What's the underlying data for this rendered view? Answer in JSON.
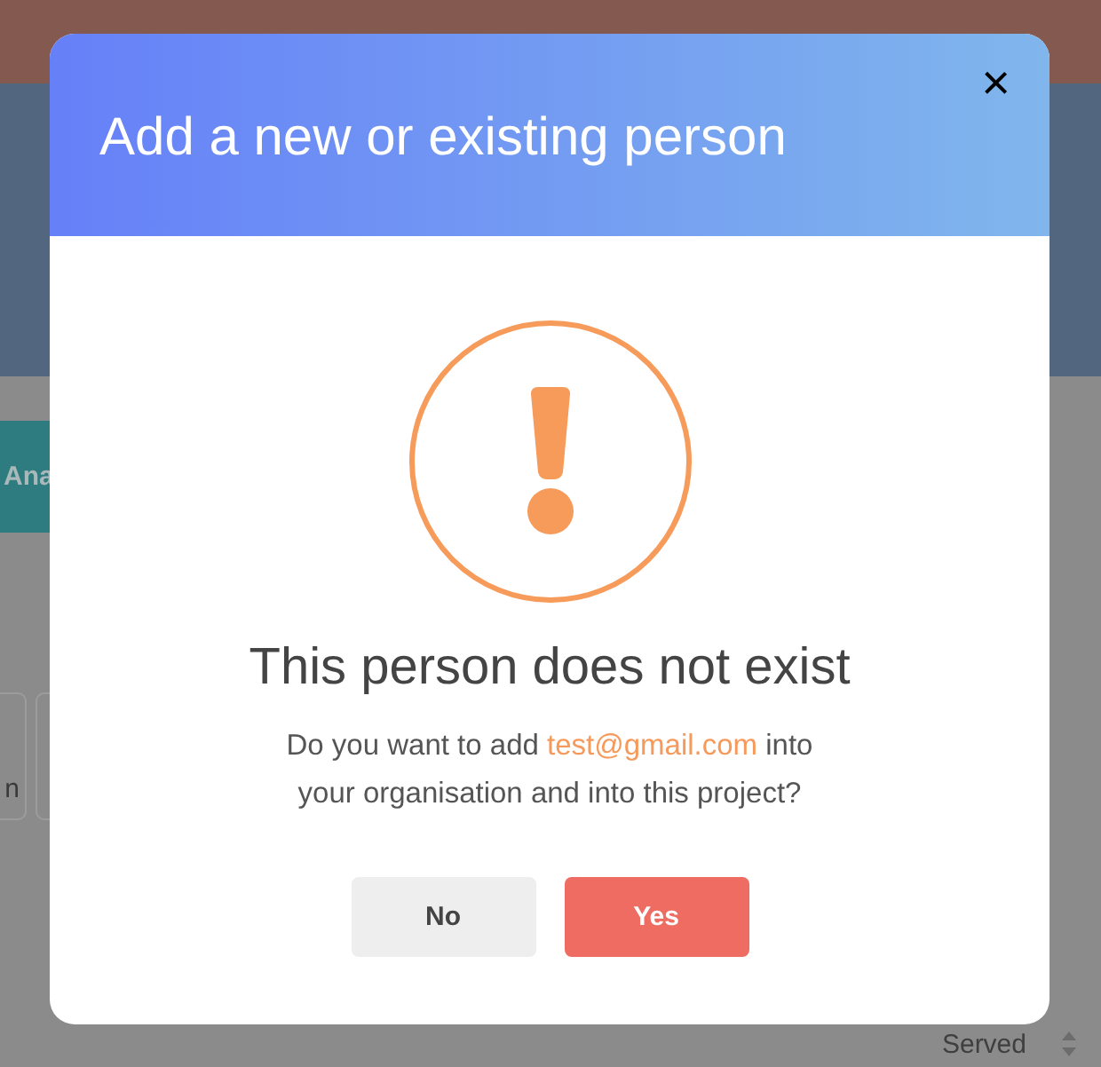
{
  "background": {
    "tab_button": "Ana",
    "card_text": "n",
    "sort_column": "Served"
  },
  "dialog": {
    "title": "Add a new or existing person",
    "close": "×",
    "heading": "This person does not exist",
    "message": {
      "before": "Do you want to add ",
      "email": "test@gmail.com",
      "after": " into your organisation and into this project?"
    },
    "buttons": [
      {
        "label": "No",
        "kind": "secondary"
      },
      {
        "label": "Yes",
        "kind": "primary"
      }
    ]
  }
}
